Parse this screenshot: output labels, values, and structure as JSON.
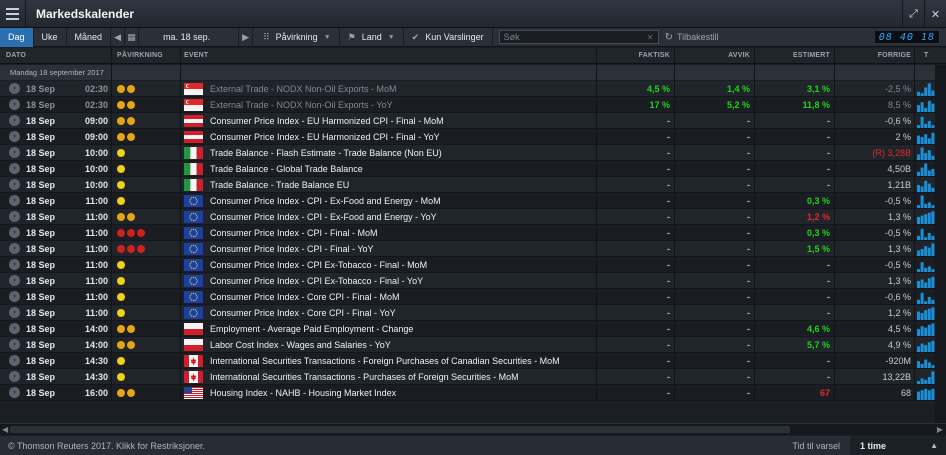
{
  "window": {
    "title": "Markedskalender"
  },
  "toolbar": {
    "views": [
      "Dag",
      "Uke",
      "Måned"
    ],
    "active_view": "Dag",
    "date_label": "ma. 18 sep.",
    "impact_label": "Påvirkning",
    "country_label": "Land",
    "alerts_label": "Kun Varslinger",
    "search_placeholder": "Søk",
    "reset_label": "Tilbakestill",
    "clock": "08 40 18"
  },
  "columns": {
    "date": "DATO",
    "impact": "PÅVIRKNING",
    "event": "EVENT",
    "actual": "FAKTISK",
    "deviation": "AVVIK",
    "estimate": "ESTIMERT",
    "previous": "FORRIGE"
  },
  "group_label": "Mandag 18 september 2017",
  "colors": {
    "green": "#26d01e",
    "red": "#e02a2a",
    "accent": "#2a6fb0",
    "spark": "#1a8fd8"
  },
  "rows": [
    {
      "date": "18 Sep",
      "time": "02:30",
      "impact": [
        "o",
        "o"
      ],
      "flag": "sg",
      "event": "External Trade - NODX Non-Oil Exports - MoM",
      "actual": "4,5 %",
      "actual_c": "green",
      "dev": "1,4 %",
      "dev_c": "green",
      "est": "3,1 %",
      "est_c": "green",
      "prev": "-2,5 %",
      "past": true,
      "spark": [
        0.3,
        0.2,
        0.6,
        0.9,
        0.4
      ]
    },
    {
      "date": "18 Sep",
      "time": "02:30",
      "impact": [
        "o",
        "o"
      ],
      "flag": "sg",
      "event": "External Trade - NODX Non-Oil Exports - YoY",
      "actual": "17 %",
      "actual_c": "green",
      "dev": "5,2 %",
      "dev_c": "green",
      "est": "11,8 %",
      "est_c": "green",
      "prev": "8,5 %",
      "past": true,
      "spark": [
        0.5,
        0.7,
        0.3,
        0.8,
        0.6
      ]
    },
    {
      "date": "18 Sep",
      "time": "09:00",
      "impact": [
        "o",
        "o"
      ],
      "flag": "at",
      "event": "Consumer Price Index - EU Harmonized CPI - Final - MoM",
      "actual": "-",
      "dev": "-",
      "est": "-",
      "prev": "-0,6 %",
      "spark": [
        0.2,
        0.8,
        0.3,
        0.5,
        0.2
      ]
    },
    {
      "date": "18 Sep",
      "time": "09:00",
      "impact": [
        "o",
        "o"
      ],
      "flag": "at",
      "event": "Consumer Price Index - EU Harmonized CPI - Final - YoY",
      "actual": "-",
      "dev": "-",
      "est": "-",
      "prev": "2 %",
      "spark": [
        0.6,
        0.5,
        0.7,
        0.4,
        0.8
      ]
    },
    {
      "date": "18 Sep",
      "time": "10:00",
      "impact": [
        "y"
      ],
      "flag": "it",
      "event": "Trade Balance - Flash Estimate - Trade Balance (Non EU)",
      "actual": "-",
      "dev": "-",
      "est": "-",
      "prev": "(R) 3,28B",
      "prev_c": "red",
      "spark": [
        0.4,
        0.9,
        0.5,
        0.7,
        0.3
      ]
    },
    {
      "date": "18 Sep",
      "time": "10:00",
      "impact": [
        "y"
      ],
      "flag": "it",
      "event": "Trade Balance - Global Trade Balance",
      "actual": "-",
      "dev": "-",
      "est": "-",
      "prev": "4,50B",
      "spark": [
        0.3,
        0.6,
        0.9,
        0.4,
        0.5
      ]
    },
    {
      "date": "18 Sep",
      "time": "10:00",
      "impact": [
        "y"
      ],
      "flag": "it",
      "event": "Trade Balance - Trade Balance EU",
      "actual": "-",
      "dev": "-",
      "est": "-",
      "prev": "1,21B",
      "spark": [
        0.5,
        0.4,
        0.8,
        0.6,
        0.3
      ]
    },
    {
      "date": "18 Sep",
      "time": "11:00",
      "impact": [
        "y"
      ],
      "flag": "eu",
      "event": "Consumer Price Index - CPI - Ex-Food and Energy - MoM",
      "actual": "-",
      "dev": "-",
      "est": "0,3 %",
      "est_c": "green",
      "prev": "-0,5 %",
      "spark": [
        0.2,
        0.9,
        0.3,
        0.4,
        0.2
      ]
    },
    {
      "date": "18 Sep",
      "time": "11:00",
      "impact": [
        "o",
        "o"
      ],
      "flag": "eu",
      "event": "Consumer Price Index - CPI - Ex-Food and Energy - YoY",
      "actual": "-",
      "dev": "-",
      "est": "1,2 %",
      "est_c": "red",
      "prev": "1,3 %",
      "spark": [
        0.5,
        0.6,
        0.7,
        0.8,
        0.9
      ]
    },
    {
      "date": "18 Sep",
      "time": "11:00",
      "impact": [
        "r",
        "r",
        "r"
      ],
      "flag": "eu",
      "event": "Consumer Price Index - CPI - Final - MoM",
      "actual": "-",
      "dev": "-",
      "est": "0,3 %",
      "est_c": "green",
      "prev": "-0,5 %",
      "spark": [
        0.3,
        0.8,
        0.2,
        0.5,
        0.3
      ]
    },
    {
      "date": "18 Sep",
      "time": "11:00",
      "impact": [
        "r",
        "r",
        "r"
      ],
      "flag": "eu",
      "event": "Consumer Price Index - CPI - Final - YoY",
      "actual": "-",
      "dev": "-",
      "est": "1,5 %",
      "est_c": "green",
      "prev": "1,3 %",
      "spark": [
        0.4,
        0.5,
        0.7,
        0.6,
        0.9
      ]
    },
    {
      "date": "18 Sep",
      "time": "11:00",
      "impact": [
        "y"
      ],
      "flag": "eu",
      "event": "Consumer Price Index - CPI Ex-Tobacco - Final - MoM",
      "actual": "-",
      "dev": "-",
      "est": "-",
      "prev": "-0,5 %",
      "spark": [
        0.2,
        0.7,
        0.3,
        0.4,
        0.2
      ]
    },
    {
      "date": "18 Sep",
      "time": "11:00",
      "impact": [
        "y"
      ],
      "flag": "eu",
      "event": "Consumer Price Index - CPI Ex-Tobacco - Final - YoY",
      "actual": "-",
      "dev": "-",
      "est": "-",
      "prev": "1,3 %",
      "spark": [
        0.5,
        0.6,
        0.4,
        0.7,
        0.8
      ]
    },
    {
      "date": "18 Sep",
      "time": "11:00",
      "impact": [
        "y"
      ],
      "flag": "eu",
      "event": "Consumer Price Index - Core CPI - Final - MoM",
      "actual": "-",
      "dev": "-",
      "est": "-",
      "prev": "-0,6 %",
      "spark": [
        0.3,
        0.8,
        0.2,
        0.5,
        0.3
      ]
    },
    {
      "date": "18 Sep",
      "time": "11:00",
      "impact": [
        "y"
      ],
      "flag": "eu",
      "event": "Consumer Price Index - Core CPI - Final - YoY",
      "actual": "-",
      "dev": "-",
      "est": "-",
      "prev": "1,2 %",
      "spark": [
        0.6,
        0.5,
        0.7,
        0.8,
        0.9
      ]
    },
    {
      "date": "18 Sep",
      "time": "14:00",
      "impact": [
        "o",
        "o"
      ],
      "flag": "pl",
      "event": "Employment - Average Paid Employment - Change",
      "actual": "-",
      "dev": "-",
      "est": "4,6 %",
      "est_c": "green",
      "prev": "4,5 %",
      "spark": [
        0.5,
        0.7,
        0.6,
        0.8,
        0.9
      ]
    },
    {
      "date": "18 Sep",
      "time": "14:00",
      "impact": [
        "o",
        "o"
      ],
      "flag": "pl",
      "event": "Labor Cost Index - Wages and Salaries - YoY",
      "actual": "-",
      "dev": "-",
      "est": "5,7 %",
      "est_c": "green",
      "prev": "4,9 %",
      "spark": [
        0.4,
        0.6,
        0.5,
        0.7,
        0.8
      ]
    },
    {
      "date": "18 Sep",
      "time": "14:30",
      "impact": [
        "y"
      ],
      "flag": "ca",
      "event": "International Securities Transactions - Foreign Purchases of Canadian Securities - MoM",
      "actual": "-",
      "dev": "-",
      "est": "-",
      "prev": "-920M",
      "spark": [
        0.5,
        0.3,
        0.6,
        0.4,
        0.2
      ]
    },
    {
      "date": "18 Sep",
      "time": "14:30",
      "impact": [
        "y"
      ],
      "flag": "ca",
      "event": "International Securities Transactions - Purchases of Foreign Securities - MoM",
      "actual": "-",
      "dev": "-",
      "est": "-",
      "prev": "13,22B",
      "spark": [
        0.2,
        0.4,
        0.3,
        0.5,
        0.9
      ]
    },
    {
      "date": "18 Sep",
      "time": "16:00",
      "impact": [
        "o",
        "o"
      ],
      "flag": "us",
      "event": "Housing Index - NAHB - Housing Market Index",
      "actual": "-",
      "dev": "-",
      "est": "67",
      "est_c": "red",
      "prev": "68",
      "spark": [
        0.6,
        0.7,
        0.8,
        0.7,
        0.8
      ]
    }
  ],
  "footer": {
    "copyright": "© Thomson Reuters 2017. Klikk for Restriksjoner.",
    "alert_label": "Tid til varsel",
    "alert_value": "1 time"
  }
}
